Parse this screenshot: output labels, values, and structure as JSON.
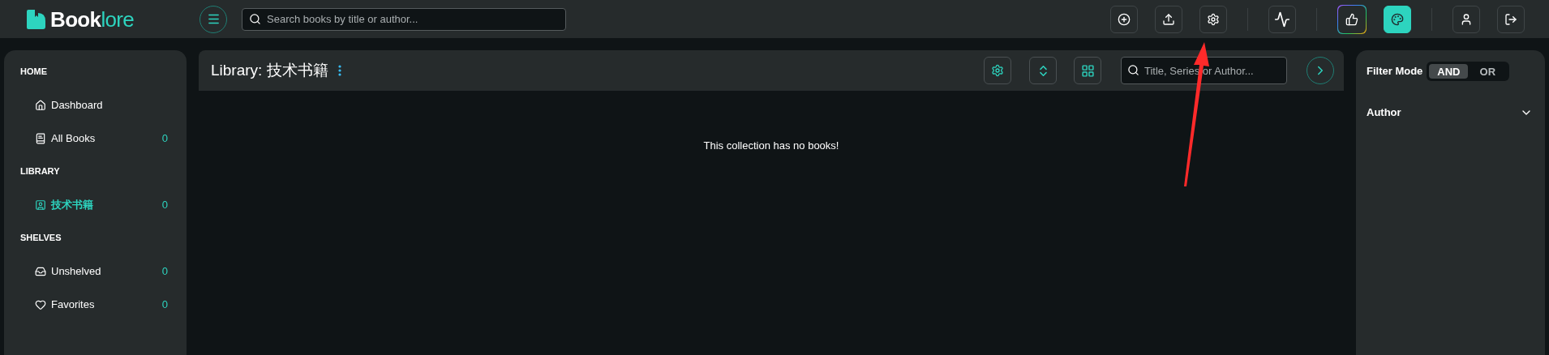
{
  "header": {
    "logo": {
      "first": "Book",
      "second": "lore"
    },
    "search": {
      "placeholder": "Search books by title or author..."
    },
    "toolbar": [
      {
        "kind": "add",
        "active": false
      },
      {
        "kind": "upload",
        "active": false
      },
      {
        "kind": "settings",
        "active": false
      },
      {
        "kind": "divider"
      },
      {
        "kind": "activity",
        "active": false
      },
      {
        "kind": "divider"
      },
      {
        "kind": "like",
        "active": false
      },
      {
        "kind": "theme",
        "active": true
      },
      {
        "kind": "divider"
      },
      {
        "kind": "user",
        "active": false
      },
      {
        "kind": "logout",
        "active": false
      }
    ]
  },
  "sidebar": {
    "sections": [
      {
        "title": "HOME",
        "items": [
          {
            "kind": "home",
            "label": "Dashboard",
            "selected": false
          },
          {
            "kind": "book",
            "label": "All Books",
            "count": "0",
            "selected": false
          }
        ]
      },
      {
        "title": "LIBRARY",
        "items": [
          {
            "kind": "library",
            "label": "技术书籍",
            "count": "0",
            "selected": true
          }
        ]
      },
      {
        "title": "SHELVES",
        "items": [
          {
            "kind": "inbox",
            "label": "Unshelved",
            "count": "0",
            "selected": false
          },
          {
            "kind": "heart",
            "label": "Favorites",
            "count": "0",
            "selected": false
          }
        ]
      }
    ]
  },
  "main": {
    "title": "Library: 技术书籍",
    "search": {
      "placeholder": "Title, Series or Author..."
    },
    "empty_message": "This collection has no books!"
  },
  "filters": {
    "label": "Filter Mode",
    "modes": [
      {
        "label": "AND",
        "selected": true
      },
      {
        "label": "OR",
        "selected": false
      }
    ],
    "sections": [
      {
        "label": "Author",
        "expanded": false
      }
    ]
  }
}
